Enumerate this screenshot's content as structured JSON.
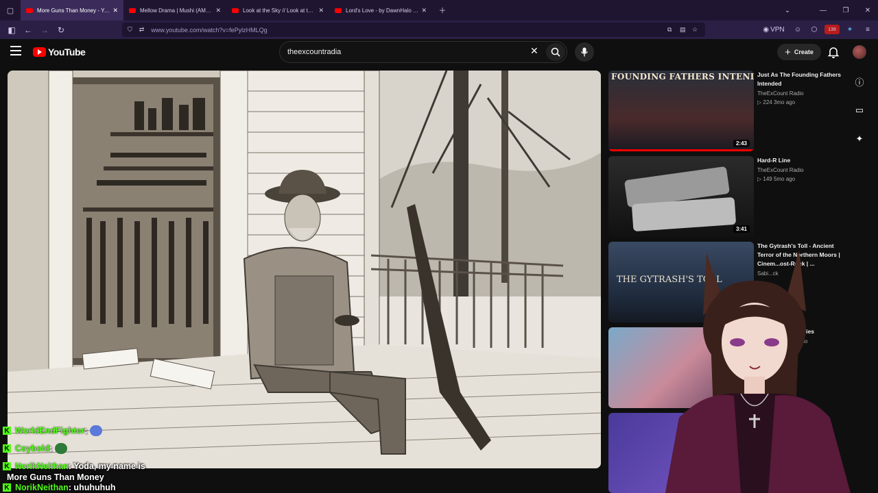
{
  "browser": {
    "tabs": [
      {
        "title": "More Guns Than Money - YouTube",
        "active": true
      },
      {
        "title": "Mellow Drama | Mushi (AMV) (E",
        "active": false
      },
      {
        "title": "Look at the Sky // Look at the S",
        "active": false
      },
      {
        "title": "Lord's Love - by DawnHalo - Yo",
        "active": false
      }
    ],
    "url": "www.youtube.com/watch?v=fePylzHMLQg",
    "vpn_label": "VPN",
    "badge_count": "136"
  },
  "youtube": {
    "logo_text": "YouTube",
    "search_value": "theexcountradia",
    "create_label": "Create"
  },
  "recommendations": [
    {
      "title": "Just As The Founding Fathers Intended",
      "channel": "TheExCount Radio",
      "stats": "▷ 224  3mo ago",
      "duration": "2:43",
      "thumb_text": "FOUNDING FATHERS INTENDED"
    },
    {
      "title": "Hard-R Line",
      "channel": "TheExCount Radio",
      "stats": "▷ 149  5mo ago",
      "duration": "3:41"
    },
    {
      "title": "The Gytrash's Toll - Ancient Terror of the Northern Moors | Cinem...ost-Rock | ...",
      "channel": "Sabi...ck",
      "stats": "",
      "thumb_text": "THE GYTRASH'S TOLL"
    },
    {
      "title": "Ladies",
      "channel": "...dio",
      "stats": ""
    }
  ],
  "chat": [
    {
      "user": "WorldEndFighter",
      "message": ":"
    },
    {
      "user": "Coybold",
      "message": ":"
    },
    {
      "user": "NorikNeithan",
      "message": ": Yoda, my name is"
    },
    {
      "user": "",
      "message": "More Guns Than Money"
    },
    {
      "user": "NorikNeithan",
      "message": ": uhuhuhuh"
    }
  ],
  "colors": {
    "accent": "#ff0000",
    "chat_user": "#53fc18",
    "chrome_bg": "#1f1531"
  }
}
